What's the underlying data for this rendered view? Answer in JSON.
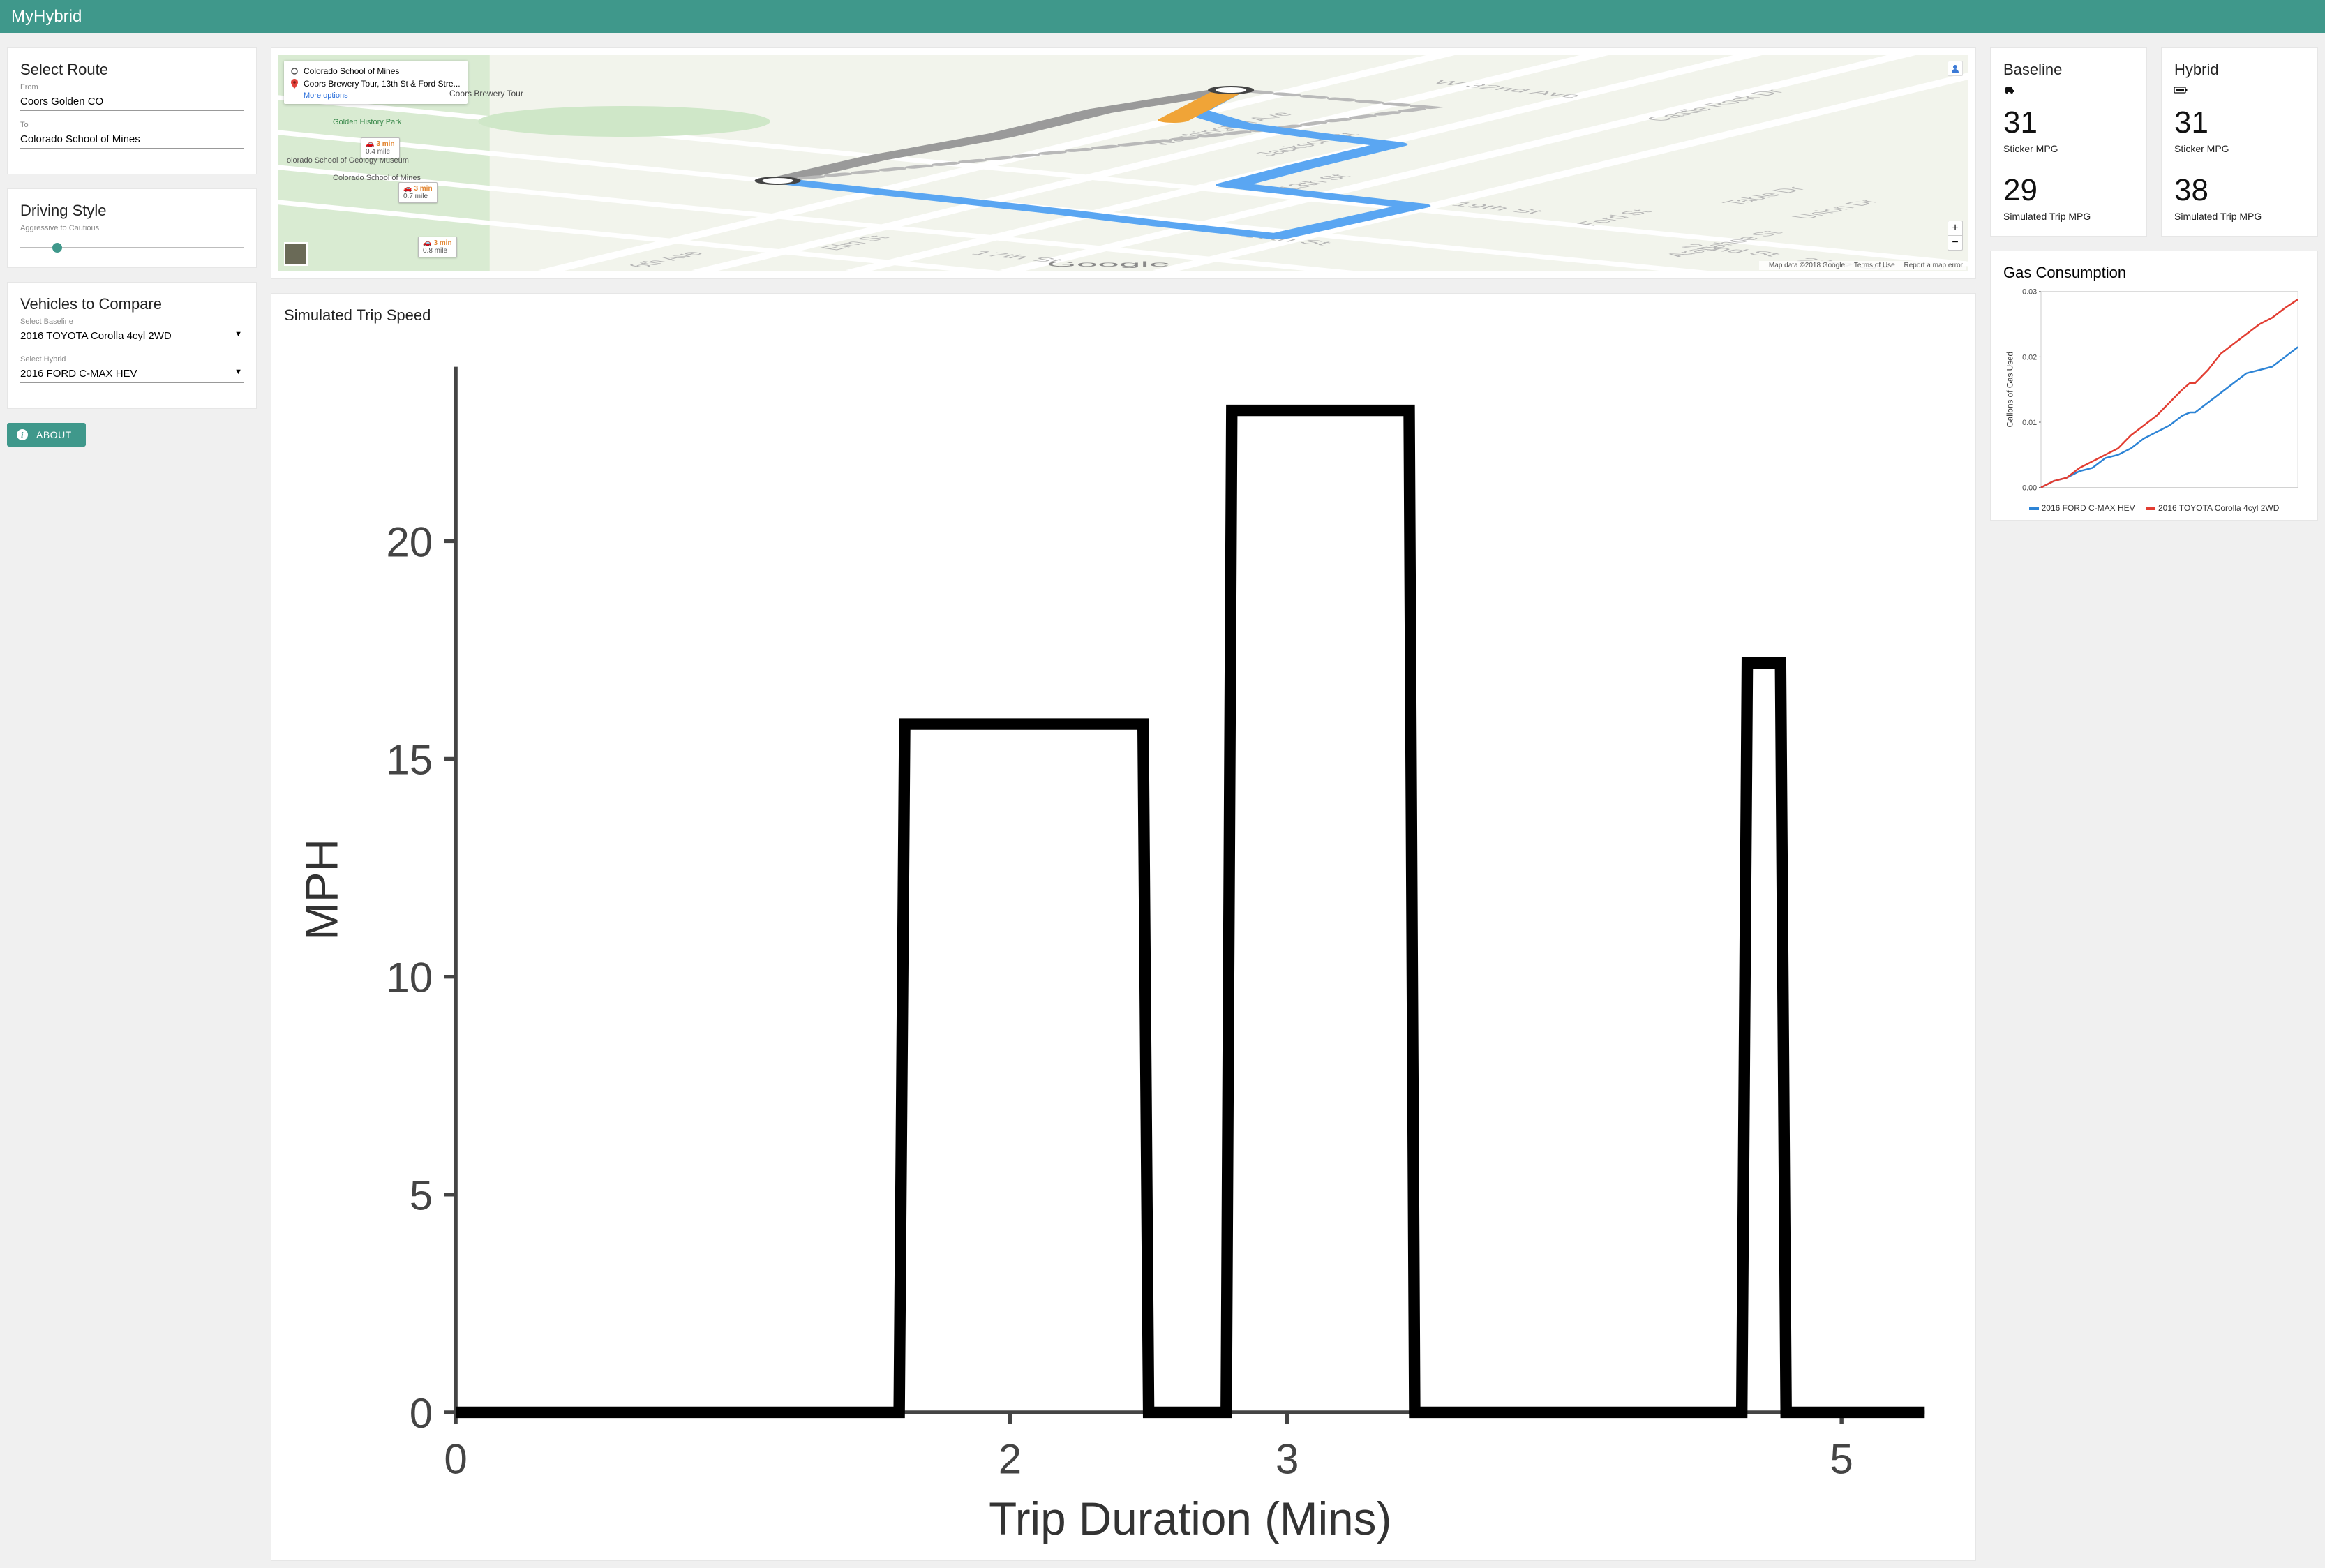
{
  "app": {
    "title": "MyHybrid"
  },
  "route": {
    "heading": "Select Route",
    "from_label": "From",
    "from_value": "Coors Golden CO",
    "to_label": "To",
    "to_value": "Colorado School of Mines"
  },
  "driving": {
    "heading": "Driving Style",
    "sublabel": "Aggressive to Cautious",
    "slider_value": 15
  },
  "vehicles": {
    "heading": "Vehicles to Compare",
    "baseline_label": "Select Baseline",
    "baseline_value": "2016 TOYOTA Corolla 4cyl 2WD",
    "hybrid_label": "Select Hybrid",
    "hybrid_value": "2016 FORD C-MAX HEV"
  },
  "about": {
    "label": "ABOUT"
  },
  "map": {
    "origin": "Colorado School of Mines",
    "destination": "Coors Brewery Tour, 13th St & Ford Stre...",
    "more_options": "More options",
    "dest_label_on_map": "Coors Brewery Tour",
    "place_museum": "olorado School of\nGeology Museum",
    "place_park": "Golden History Park",
    "place_csm": "Colorado\nSchool of Mines",
    "attrib_data": "Map data ©2018 Google",
    "attrib_terms": "Terms of Use",
    "attrib_report": "Report a map error",
    "route_labels": [
      {
        "time": "3 min",
        "dist": "0.4 mile",
        "top": 118,
        "left": 118
      },
      {
        "time": "3 min",
        "dist": "0.7 mile",
        "top": 182,
        "left": 172
      },
      {
        "time": "3 min",
        "dist": "0.8 mile",
        "top": 260,
        "left": 200
      }
    ]
  },
  "stats": {
    "baseline": {
      "title": "Baseline",
      "sticker": "31",
      "sticker_label": "Sticker MPG",
      "sim": "29",
      "sim_label": "Simulated Trip MPG"
    },
    "hybrid": {
      "title": "Hybrid",
      "sticker": "31",
      "sticker_label": "Sticker MPG",
      "sim": "38",
      "sim_label": "Simulated Trip MPG"
    }
  },
  "chart_data": [
    {
      "id": "speed",
      "type": "line",
      "title": "Simulated Trip Speed",
      "xlabel": "Trip Duration (Mins)",
      "ylabel": "MPH",
      "xlim": [
        0,
        5.3
      ],
      "ylim": [
        0,
        24
      ],
      "x_ticks": [
        0,
        2,
        3,
        5
      ],
      "y_ticks": [
        0,
        5,
        10,
        15,
        20
      ],
      "series": [
        {
          "name": "Speed",
          "color": "#000000",
          "x": [
            0,
            1.6,
            1.62,
            2.48,
            2.5,
            2.78,
            2.8,
            3.44,
            3.46,
            4.64,
            4.66,
            4.78,
            4.8,
            5.3
          ],
          "values": [
            0,
            0,
            15.8,
            15.8,
            0,
            0,
            23,
            23,
            0,
            0,
            17.2,
            17.2,
            0,
            0
          ]
        }
      ]
    },
    {
      "id": "gas",
      "type": "line",
      "title": "Gas Consumption",
      "xlabel": "",
      "ylabel": "Gallons of Gas Used",
      "xlim": [
        0,
        1
      ],
      "ylim": [
        0,
        0.03
      ],
      "x_ticks": [],
      "y_ticks": [
        0.0,
        0.01,
        0.02,
        0.03
      ],
      "legend_position": "bottom-center",
      "colors": {
        "ford": "#2d84d6",
        "toyota": "#e23d32"
      },
      "series": [
        {
          "name": "2016 FORD C-MAX HEV",
          "color": "#2d84d6",
          "x": [
            0.0,
            0.05,
            0.1,
            0.15,
            0.2,
            0.25,
            0.3,
            0.35,
            0.4,
            0.45,
            0.5,
            0.55,
            0.58,
            0.6,
            0.65,
            0.7,
            0.75,
            0.8,
            0.85,
            0.9,
            0.95,
            1.0
          ],
          "values": [
            0.0,
            0.001,
            0.0015,
            0.0025,
            0.003,
            0.0045,
            0.005,
            0.006,
            0.0075,
            0.0085,
            0.0095,
            0.011,
            0.0115,
            0.0115,
            0.013,
            0.0145,
            0.016,
            0.0175,
            0.018,
            0.0185,
            0.02,
            0.0215
          ]
        },
        {
          "name": "2016 TOYOTA Corolla 4cyl 2WD",
          "color": "#e23d32",
          "x": [
            0.0,
            0.05,
            0.1,
            0.15,
            0.2,
            0.25,
            0.3,
            0.35,
            0.4,
            0.45,
            0.5,
            0.55,
            0.58,
            0.6,
            0.65,
            0.7,
            0.75,
            0.8,
            0.85,
            0.9,
            0.95,
            1.0
          ],
          "values": [
            0.0,
            0.001,
            0.0015,
            0.003,
            0.004,
            0.005,
            0.006,
            0.008,
            0.0095,
            0.011,
            0.013,
            0.015,
            0.016,
            0.016,
            0.018,
            0.0205,
            0.022,
            0.0235,
            0.025,
            0.026,
            0.0275,
            0.0288
          ]
        }
      ]
    }
  ]
}
